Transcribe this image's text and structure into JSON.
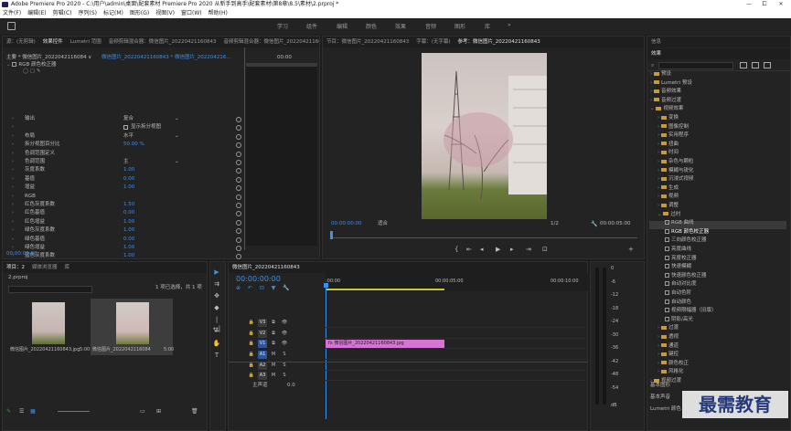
{
  "window": {
    "title": "Adobe Premiere Pro 2020 - C:\\用户\\admin\\桌面\\配套素材 Premiere Pro 2020 从新手到高手\\配套素材\\第8章\\8.5\\素材\\2.prproj *",
    "min": "—",
    "max": "⧠",
    "close": "✕"
  },
  "menu": [
    "文件(F)",
    "编辑(E)",
    "剪辑(C)",
    "序列(S)",
    "标记(M)",
    "图形(G)",
    "视图(V)",
    "窗口(W)",
    "帮助(H)"
  ],
  "workspaces": [
    "学习",
    "组件",
    "编辑",
    "颜色",
    "效果",
    "音频",
    "图形",
    "库",
    "»"
  ],
  "ec": {
    "tabs": [
      "源：(无剪辑)",
      "效果控件",
      "Lumetri 范围",
      "音频剪辑混合器：微信图片_20220421160843",
      "音频剪辑混合器：微信图片_20220421160843"
    ],
    "master": "主要 * 微信图片_2022042116084 ∨",
    "seq": "微信图片_20220421160843 * 微信图片_202204216...",
    "time": "00:00",
    "section": "RGB 颜色校正器",
    "rows": [
      {
        "label": "输出",
        "value": "复合",
        "type": "dropdown"
      },
      {
        "label": "",
        "value": "显示拆分视图",
        "type": "checkbox"
      },
      {
        "label": "布局",
        "value": "水平",
        "type": "dropdown"
      },
      {
        "label": "拆分视图百分比",
        "value": "50.00 %",
        "type": "blue"
      },
      {
        "label": "色调范围定义",
        "value": "",
        "type": "plain"
      },
      {
        "label": "色调范围",
        "value": "主",
        "type": "dropdown"
      },
      {
        "label": "灰度系数",
        "value": "1.00",
        "type": "blue"
      },
      {
        "label": "基值",
        "value": "0.00",
        "type": "blue"
      },
      {
        "label": "增益",
        "value": "1.00",
        "type": "blue"
      },
      {
        "label": "RGB",
        "value": "",
        "type": "plain"
      },
      {
        "label": "红色灰度系数",
        "value": "1.50",
        "type": "blue"
      },
      {
        "label": "红色基值",
        "value": "0.00",
        "type": "blue"
      },
      {
        "label": "红色增益",
        "value": "1.00",
        "type": "blue"
      },
      {
        "label": "绿色灰度系数",
        "value": "1.00",
        "type": "blue"
      },
      {
        "label": "绿色基值",
        "value": "0.00",
        "type": "blue"
      },
      {
        "label": "绿色增益",
        "value": "1.00",
        "type": "blue"
      },
      {
        "label": "蓝色灰度系数",
        "value": "1.00",
        "type": "blue"
      },
      {
        "label": "蓝色基值",
        "value": "0.00",
        "type": "blue"
      },
      {
        "label": "蓝色增益",
        "value": "1.00",
        "type": "blue"
      },
      {
        "label": "辅助颜色校正",
        "value": "",
        "type": "plain"
      }
    ],
    "footer": "00:00:00:00"
  },
  "program": {
    "tabs": [
      "节目：微信图片_20220421160843",
      "字幕：(无字幕)",
      "参考：微信图片_20220421160843"
    ],
    "timecode": "00:00:00:00",
    "fit": "适合",
    "quality": "1/2",
    "duration": "00:00:05:00"
  },
  "project": {
    "tabs": [
      "项目：2",
      "媒体浏览器",
      "库"
    ],
    "name": "2.prproj",
    "count": "1 项已选择，共 1 项",
    "items": [
      {
        "name": "微信图片_20220421160843.jpg",
        "dur": "5:00"
      },
      {
        "name": "微信图片_2022042116084",
        "dur": "5:00"
      }
    ]
  },
  "timeline": {
    "tab": "微信图片_20220421160843",
    "timecode": "00:00:00:00",
    "ruler": [
      ":00:00",
      "00:00:05:00",
      "00:00:10:00"
    ],
    "tracks": [
      "V3",
      "V2",
      "V1",
      "A1",
      "A2",
      "A3"
    ],
    "master": "主声道",
    "masterval": "0.0",
    "clip": "微信图片_20220421160843.jpg",
    "fx": "fx"
  },
  "meter": {
    "labels": [
      "0",
      "-6",
      "-12",
      "-18",
      "-24",
      "-30",
      "-36",
      "-42",
      "-48",
      "-54"
    ],
    "unit": "dB"
  },
  "effects": {
    "tabs": [
      "信息",
      "效果"
    ],
    "rows": [
      {
        "label": "预设",
        "level": 0,
        "type": "folder"
      },
      {
        "label": "Lumetri 预设",
        "level": 0,
        "type": "folder"
      },
      {
        "label": "音频效果",
        "level": 0,
        "type": "folder"
      },
      {
        "label": "音频过渡",
        "level": 0,
        "type": "folder"
      },
      {
        "label": "视频效果",
        "level": 0,
        "type": "folder",
        "open": true
      },
      {
        "label": "变换",
        "level": 1,
        "type": "folder"
      },
      {
        "label": "图像控制",
        "level": 1,
        "type": "folder"
      },
      {
        "label": "实用程序",
        "level": 1,
        "type": "folder"
      },
      {
        "label": "扭曲",
        "level": 1,
        "type": "folder"
      },
      {
        "label": "时间",
        "level": 1,
        "type": "folder"
      },
      {
        "label": "杂色与颗粒",
        "level": 1,
        "type": "folder"
      },
      {
        "label": "模糊与锐化",
        "level": 1,
        "type": "folder"
      },
      {
        "label": "沉浸式视频",
        "level": 1,
        "type": "folder"
      },
      {
        "label": "生成",
        "level": 1,
        "type": "folder"
      },
      {
        "label": "视频",
        "level": 1,
        "type": "folder"
      },
      {
        "label": "调整",
        "level": 1,
        "type": "folder"
      },
      {
        "label": "过时",
        "level": 1,
        "type": "folder",
        "open": true
      },
      {
        "label": "RGB 曲线",
        "level": 2,
        "type": "fx"
      },
      {
        "label": "RGB 颜色校正器",
        "level": 2,
        "type": "fx",
        "selected": true
      },
      {
        "label": "三向颜色校正器",
        "level": 2,
        "type": "fx"
      },
      {
        "label": "亮度曲线",
        "level": 2,
        "type": "fx"
      },
      {
        "label": "亮度校正器",
        "level": 2,
        "type": "fx"
      },
      {
        "label": "快速模糊",
        "level": 2,
        "type": "fx"
      },
      {
        "label": "快速颜色校正器",
        "level": 2,
        "type": "fx"
      },
      {
        "label": "自动对比度",
        "level": 2,
        "type": "fx"
      },
      {
        "label": "自动色阶",
        "level": 2,
        "type": "fx"
      },
      {
        "label": "自动颜色",
        "level": 2,
        "type": "fx"
      },
      {
        "label": "视频限幅器（旧版）",
        "level": 2,
        "type": "fx"
      },
      {
        "label": "阴影/高光",
        "level": 2,
        "type": "fx"
      },
      {
        "label": "过渡",
        "level": 1,
        "type": "folder"
      },
      {
        "label": "透视",
        "level": 1,
        "type": "folder"
      },
      {
        "label": "通道",
        "level": 1,
        "type": "folder"
      },
      {
        "label": "键控",
        "level": 1,
        "type": "folder"
      },
      {
        "label": "颜色校正",
        "level": 1,
        "type": "folder"
      },
      {
        "label": "风格化",
        "level": 1,
        "type": "folder"
      },
      {
        "label": "视频过渡",
        "level": 0,
        "type": "folder"
      }
    ],
    "bottom": [
      "基本图形",
      "基本声音",
      "Lumetri 颜色"
    ]
  },
  "watermark": "最需教育"
}
